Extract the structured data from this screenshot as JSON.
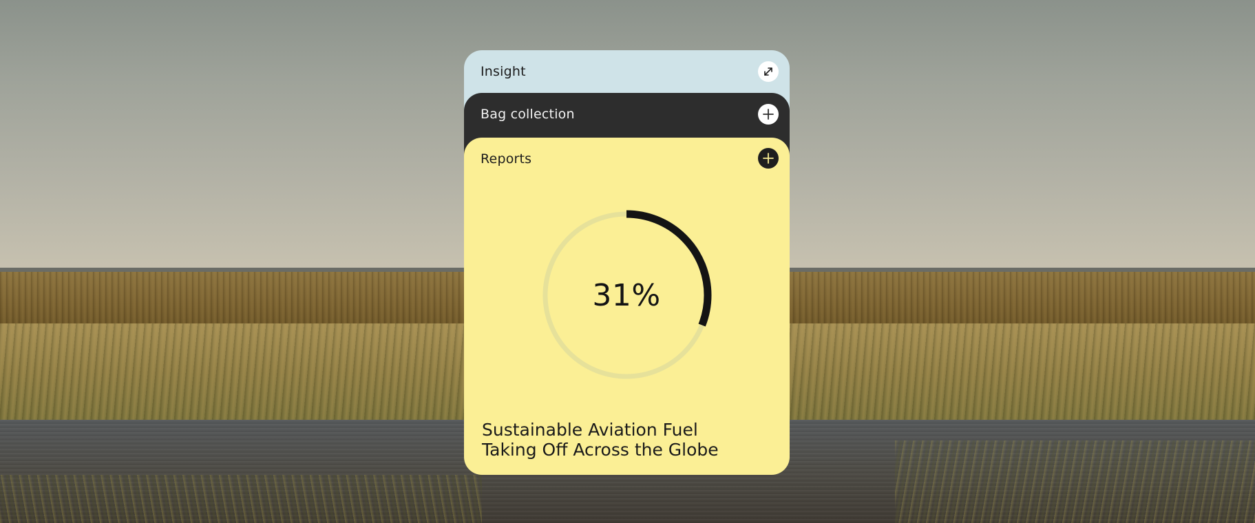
{
  "background": {
    "scene": "grassland-wetland"
  },
  "panels": {
    "insight": {
      "title": "Insight",
      "action_icon": "expand-icon",
      "color": "#cfe3e8"
    },
    "bag_collection": {
      "title": "Bag collection",
      "action_icon": "plus-icon",
      "color": "#2d2d2d"
    },
    "reports": {
      "title": "Reports",
      "action_icon": "plus-icon",
      "color": "#fbef95",
      "progress": {
        "value": 31,
        "label": "31%",
        "track_color": "#e6e19a",
        "fill_color": "#141414"
      },
      "headline": {
        "line1": "Sustainable Aviation Fuel",
        "line2": "Taking Off Across the Globe"
      }
    }
  }
}
